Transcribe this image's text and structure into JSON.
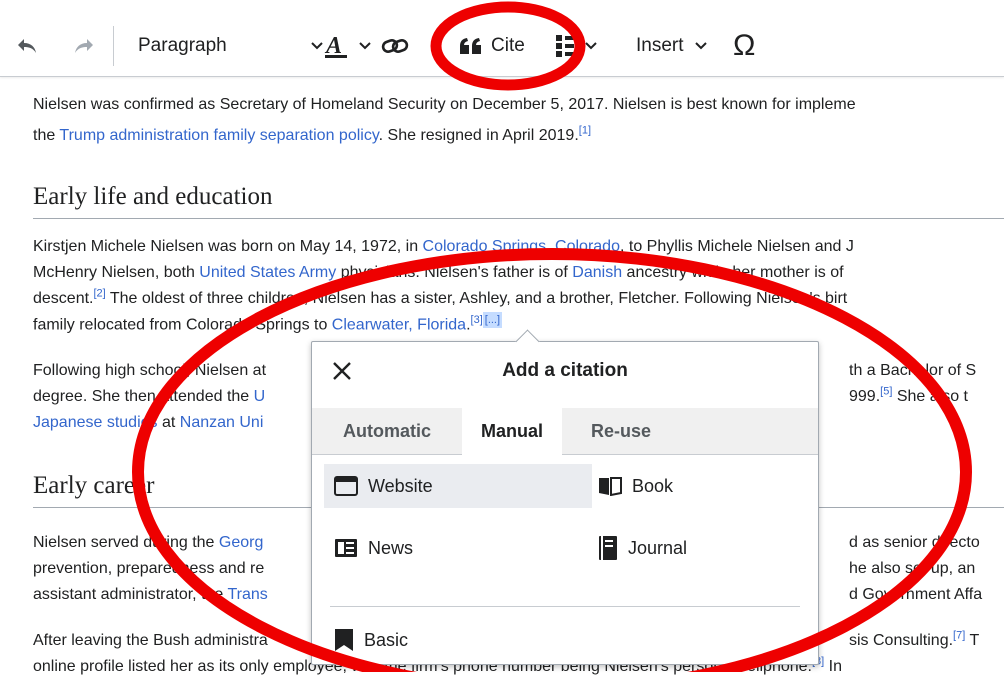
{
  "toolbar": {
    "paragraph_label": "Paragraph",
    "cite_label": "Cite",
    "insert_label": "Insert",
    "special_char": "Ω"
  },
  "article": {
    "intro": {
      "text1": "Nielsen was confirmed as Secretary of Homeland Security on December 5, 2017. Nielsen is best known for impleme",
      "text2a": "the ",
      "link1": "Trump administration family separation policy",
      "text2b": ". She resigned in April 2019.",
      "ref1": "[1]"
    },
    "heading_early_life": "Early life and education",
    "early_life": {
      "l1a": "Kirstjen Michele Nielsen was born on May 14, 1972, in ",
      "l1link": "Colorado Springs, Colorado",
      "l1b": ", to Phyllis Michele Nielsen and J",
      "l2a": "McHenry Nielsen, both ",
      "l2link1": "United States Army",
      "l2b": " physicians. Nielsen's father is of ",
      "l2link2": "Danish",
      "l2c": " ancestry while her mother is of",
      "l3a": "descent.",
      "l3ref": "[2]",
      "l3b": " The oldest of three children, Nielsen has a sister, Ashley, and a brother, Fletcher. Following Nielsen's birt",
      "l4a": "family relocated from Colorado Springs to ",
      "l4link": "Clearwater, Florida",
      "l4b": ".",
      "l4ref": "[3]",
      "l4box": "[...]"
    },
    "education": {
      "l1a": "Following high school, Nielsen at",
      "l1b": "th a Bachelor of S",
      "l2a": "degree. She then attended the ",
      "l2link": "U",
      "l2b": "999.",
      "l2ref": "[5]",
      "l2c": " She also t",
      "l3link1": "Japanese studies",
      "l3a": " at ",
      "l3link2": "Nanzan Uni"
    },
    "heading_early_career": "Early career",
    "career": {
      "l1a": "Nielsen served during the ",
      "l1link": "Georg",
      "l1b": "d as senior directo",
      "l2a": "prevention, preparedness and re",
      "l2b": "he also set up, an",
      "l3a": "assistant administrator, the ",
      "l3link": "Trans",
      "l3b": "d Government Affa",
      "l4a": "After leaving the Bush administra",
      "l4b": "sis Consulting.",
      "l4ref": "[7]",
      "l4c": " T",
      "l5a": "online profile listed her as its only employee, with the firm's phone number being Nielsen's personal cellphone.",
      "l5ref": "[8]",
      "l5b": " In"
    }
  },
  "dialog": {
    "title": "Add a citation",
    "tabs": [
      "Automatic",
      "Manual",
      "Re-use"
    ],
    "active_tab": "Manual",
    "options": {
      "website": "Website",
      "book": "Book",
      "news": "News",
      "journal": "Journal",
      "basic": "Basic"
    }
  },
  "colors": {
    "link": "#3366cc",
    "annotation": "#ee0000",
    "text": "#202122"
  }
}
